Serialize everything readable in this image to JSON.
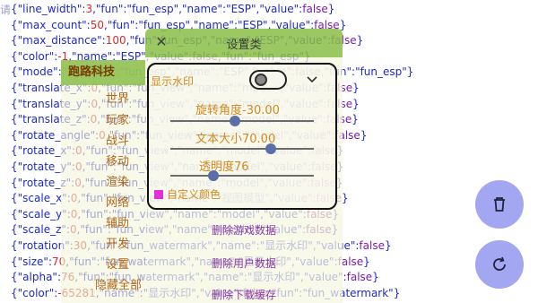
{
  "leading_char": "请",
  "code_lines": [
    {
      "parts": [
        [
          "k",
          "{\"line_width\":"
        ],
        [
          "n",
          "3"
        ],
        [
          "k",
          ",\"fun\":\"fun_esp\",\"name\":\"ESP\",\"value\":"
        ],
        [
          "b",
          "false"
        ],
        [
          "k",
          "}"
        ]
      ]
    },
    {
      "parts": [
        [
          "k",
          "{\"max_count\":"
        ],
        [
          "n",
          "50"
        ],
        [
          "k",
          ",\"fun\":\"fun_esp\",\"name\":\"ESP\",\"value\":"
        ],
        [
          "b",
          "false"
        ],
        [
          "k",
          "}"
        ]
      ]
    },
    {
      "parts": [
        [
          "k",
          "{\"max_distance\":"
        ],
        [
          "n",
          "100"
        ],
        [
          "k",
          ",\"fun\"."
        ],
        [
          "s",
          "fun_esp\",\"name\":\"ESP\",\"value\":"
        ],
        [
          "b",
          "false"
        ],
        [
          "k",
          "}"
        ]
      ]
    },
    {
      "parts": [
        [
          "k",
          "{\"color\":"
        ],
        [
          "n",
          "-1"
        ],
        [
          "k",
          ",\"name\":\"ESP\",\"value\":"
        ],
        [
          "b",
          "false"
        ],
        [
          "k",
          ",\"fun\":\"fun_esp\"}"
        ]
      ]
    },
    {
      "parts": [
        [
          "k",
          "{\"mode\":\"3d\",\"fun\":\"fun_esp\",\"name\":\"ESP\",\"value\":"
        ],
        [
          "b",
          "false"
        ],
        [
          "k",
          ",\"fun\":\"fun_esp\"}"
        ]
      ]
    },
    {
      "parts": [
        [
          "k",
          "{\"translate_x\":"
        ],
        [
          "n",
          "0"
        ],
        [
          "k",
          ",\"fun\":\"fun_view\",\"name\":\"model\",\"value\":"
        ],
        [
          "b",
          "false"
        ],
        [
          "k",
          "}"
        ]
      ]
    },
    {
      "parts": [
        [
          "k",
          "{\"translate_y\":"
        ],
        [
          "n",
          "0"
        ],
        [
          "k",
          ",\"fun\":\"fun_view\",\"name\":\"model\",\"value\":"
        ],
        [
          "b",
          "false"
        ],
        [
          "k",
          "}"
        ]
      ]
    },
    {
      "parts": [
        [
          "k",
          "{\"translate_z\":"
        ],
        [
          "n",
          "0"
        ],
        [
          "k",
          ",\"fun\":\"fun_view\",\"name\":\"model\",\"value\":"
        ],
        [
          "b",
          "false"
        ],
        [
          "k",
          "}"
        ]
      ]
    },
    {
      "parts": [
        [
          "k",
          "{\"rotate_angle\":"
        ],
        [
          "n",
          "0"
        ],
        [
          "k",
          ",\"fun\":\"fun_view\",\"name\":\"model\",\"value\":"
        ],
        [
          "b",
          "false"
        ],
        [
          "k",
          "}"
        ]
      ]
    },
    {
      "parts": [
        [
          "k",
          "{\"rotate_x\":"
        ],
        [
          "n",
          "0"
        ],
        [
          "k",
          ",\"fun\":\"fun_view\",\"name\":\"model\",\"value\":"
        ],
        [
          "b",
          "false"
        ],
        [
          "k",
          "}"
        ]
      ]
    },
    {
      "parts": [
        [
          "k",
          "{\"rotate_y\":"
        ],
        [
          "n",
          "0"
        ],
        [
          "k",
          ",\"fun\":\"fun_view\",\"name\":\"model\",\"value\":"
        ],
        [
          "b",
          "false"
        ],
        [
          "k",
          "}"
        ]
      ]
    },
    {
      "parts": [
        [
          "k",
          "{\"rotate_z\":"
        ],
        [
          "n",
          "0"
        ],
        [
          "k",
          ",\"fun\":\"fun_view\",\"name\":\"model\",\"value\":"
        ],
        [
          "b",
          "false"
        ],
        [
          "k",
          "}"
        ]
      ]
    },
    {
      "parts": [
        [
          "k",
          "{\"scale_x\":"
        ],
        [
          "n",
          "0"
        ],
        [
          "k",
          ",\"fun\":\"fun_view\",\"name\":\"视图模型\",\"value\":"
        ],
        [
          "b",
          "false"
        ],
        [
          "k",
          "}"
        ]
      ]
    },
    {
      "parts": [
        [
          "k",
          "{\"scale_y\":"
        ],
        [
          "n",
          "0"
        ],
        [
          "k",
          ",\"fun\":\"fun_view\",\"name\":\"model\",\"value\":"
        ],
        [
          "b",
          "false"
        ],
        [
          "k",
          "}"
        ]
      ]
    },
    {
      "parts": [
        [
          "k",
          "{\"scale_z\":"
        ],
        [
          "n",
          "0"
        ],
        [
          "k",
          ",\"fun\":\"fun_view\",\"name\":\"model\",\"value\":"
        ],
        [
          "b",
          "false"
        ],
        [
          "k",
          "}"
        ]
      ]
    },
    {
      "parts": [
        [
          "k",
          "{\"rotation\":"
        ],
        [
          "n",
          "30"
        ],
        [
          "k",
          ",\"fun\":\"fun_watermark\",\"name\":\"显示水印\",\"value\":"
        ],
        [
          "b",
          "false"
        ],
        [
          "k",
          "}"
        ]
      ]
    },
    {
      "parts": [
        [
          "k",
          "{\"size\":"
        ],
        [
          "n",
          "70"
        ],
        [
          "k",
          ",\"fun\":\"fun_watermark\",\"name\":\"显示水印\",\"value\":"
        ],
        [
          "b",
          "false"
        ],
        [
          "k",
          "}"
        ]
      ]
    },
    {
      "parts": [
        [
          "k",
          "{\"alpha\":"
        ],
        [
          "n",
          "76"
        ],
        [
          "k",
          ",\"fun\":\"fun_watermark\",\"name\":\"显示水印\",\"value\":"
        ],
        [
          "b",
          "false"
        ],
        [
          "k",
          "}"
        ]
      ]
    },
    {
      "parts": [
        [
          "k",
          "{\"color\":"
        ],
        [
          "n",
          "-65281"
        ],
        [
          "k",
          ",\"name\":\"显示水印\",\"value\":"
        ],
        [
          "b",
          "false"
        ],
        [
          "k",
          ",\"fun\":\"fun_watermark\"}"
        ]
      ]
    }
  ],
  "left_menu": {
    "header": "跑路科技",
    "items": [
      "世界",
      "玩家",
      "战斗",
      "移动",
      "渲染",
      "网络",
      "辅助",
      "开发",
      "设置",
      "隐藏全部"
    ]
  },
  "settings": {
    "title": "设置类",
    "close_icon": "✕",
    "watermark_label": "显示水印",
    "watermark_enabled": false,
    "expand_icon": "chevron-down-icon",
    "rotation_label": "旋转角度-30.00",
    "rotation_level": 0.45,
    "size_label": "文本大小70.00",
    "size_level": 0.7,
    "alpha_label": "透明度76",
    "alpha_level": 0.3,
    "custom_color_label": "自定义颜色",
    "custom_color": "#e030d8",
    "actions": [
      "删除游戏数据",
      "删除用户数据",
      "删除下载缓存"
    ]
  },
  "fabs": {
    "delete_icon": "trash-icon",
    "refresh_icon": "refresh-icon",
    "color": "#a3a6f1"
  }
}
